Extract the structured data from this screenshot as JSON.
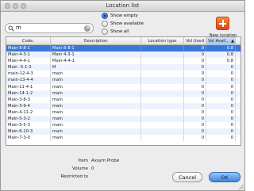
{
  "window": {
    "title": "Location list"
  },
  "search": {
    "value": "m"
  },
  "filter_options": [
    {
      "label": "Show empty",
      "selected": true
    },
    {
      "label": "Show available",
      "selected": false
    },
    {
      "label": "Show all",
      "selected": false
    }
  ],
  "new_location": {
    "label": "New location"
  },
  "table": {
    "columns": [
      "Code.",
      "Description",
      "Location type",
      "Vol Used",
      "Vol Avail..."
    ],
    "sort_indicator": "▲",
    "rows": [
      [
        "Main-8-8-1",
        "Main 8-8-1",
        "",
        "0",
        "0.8"
      ],
      [
        "Main-4-3-1",
        "Main 4-3-1",
        "",
        "0",
        "0.8"
      ],
      [
        "Main-4-4-1",
        "Main-4-4-1",
        "",
        "0",
        "0.8"
      ],
      [
        "Main -5-1-3",
        "M",
        "",
        "0",
        "0"
      ],
      [
        "main-12-4-3",
        "main",
        "",
        "0",
        "0"
      ],
      [
        "main-13-4-4",
        "main",
        "",
        "0",
        "0"
      ],
      [
        "Main-11-4-1",
        "main",
        "",
        "0",
        "0"
      ],
      [
        "Main-14-1-2",
        "main",
        "",
        "0",
        "0"
      ],
      [
        "Main-3-8-3",
        "main",
        "",
        "0",
        "0"
      ],
      [
        "Main-3-9-4",
        "main",
        "",
        "0",
        "0"
      ],
      [
        "Main-4-11-2",
        "main",
        "",
        "0",
        "0"
      ],
      [
        "Main-5-3-2",
        "main",
        "",
        "0",
        "0"
      ],
      [
        "Main-5-5-3",
        "main",
        "",
        "0",
        "0"
      ],
      [
        "Main-6-10-3",
        "main",
        "",
        "0",
        "0"
      ],
      [
        "Main-7-3-0",
        "main",
        "",
        "0",
        "0"
      ]
    ]
  },
  "details": {
    "item_label": "Item",
    "item_value": "Axsym Probe",
    "volume_label": "Volume",
    "volume_value": "0",
    "restricted_label": "Restricted to",
    "restricted_value": ""
  },
  "buttons": {
    "cancel": "Cancel",
    "ok": "OK"
  },
  "colors": {
    "selection": "#3a78d8",
    "accent": "#3f86e0",
    "new_location_icon": "#e2581f"
  }
}
